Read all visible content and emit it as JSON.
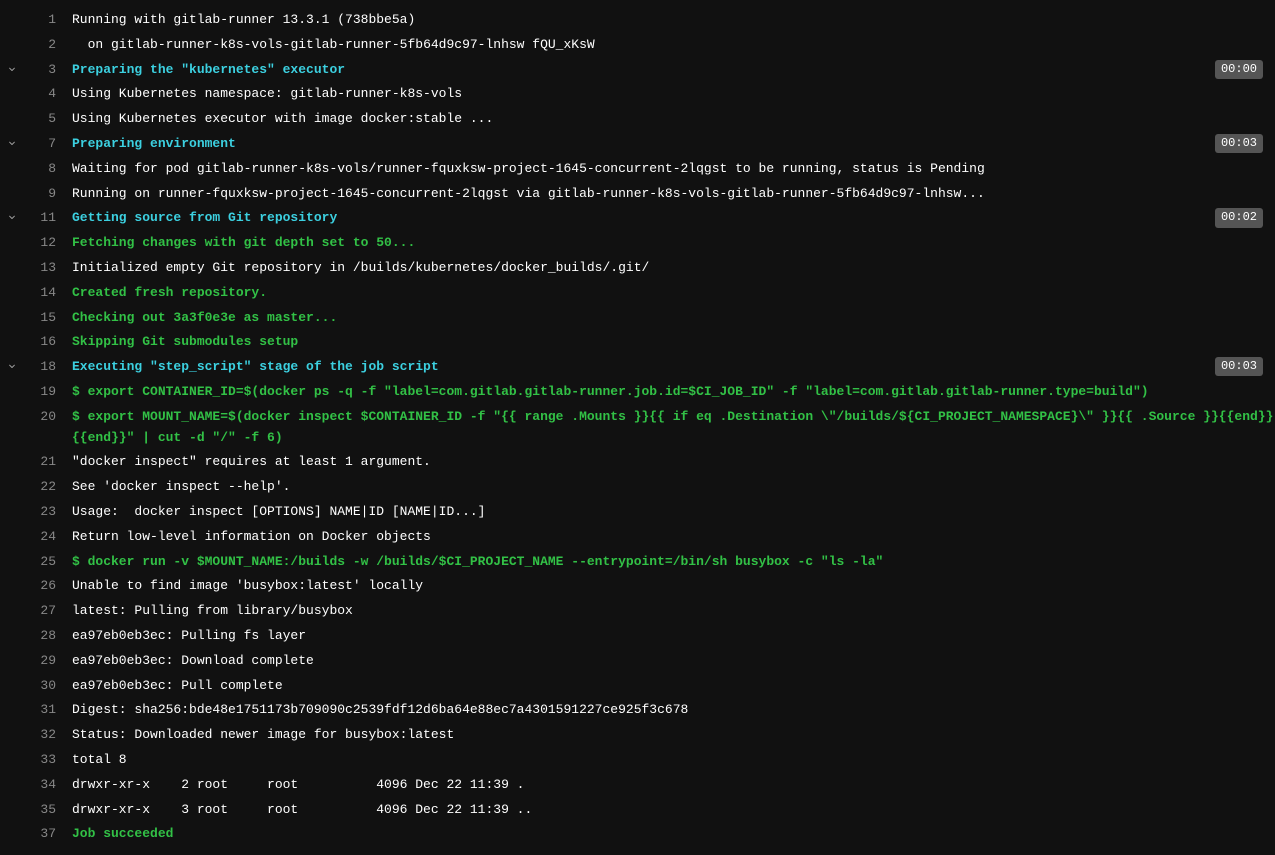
{
  "lines": [
    {
      "num": "1",
      "toggle": false,
      "style": "c-white",
      "text": "Running with gitlab-runner 13.3.1 (738bbe5a)",
      "duration": null
    },
    {
      "num": "2",
      "toggle": false,
      "style": "c-white",
      "text": "  on gitlab-runner-k8s-vols-gitlab-runner-5fb64d9c97-lnhsw fQU_xKsW",
      "duration": null
    },
    {
      "num": "3",
      "toggle": true,
      "style": "c-cyan",
      "text": "Preparing the \"kubernetes\" executor",
      "duration": "00:00"
    },
    {
      "num": "4",
      "toggle": false,
      "style": "c-white",
      "text": "Using Kubernetes namespace: gitlab-runner-k8s-vols",
      "duration": null
    },
    {
      "num": "5",
      "toggle": false,
      "style": "c-white",
      "text": "Using Kubernetes executor with image docker:stable ...",
      "duration": null
    },
    {
      "num": "7",
      "toggle": true,
      "style": "c-cyan",
      "text": "Preparing environment",
      "duration": "00:03"
    },
    {
      "num": "8",
      "toggle": false,
      "style": "c-white",
      "text": "Waiting for pod gitlab-runner-k8s-vols/runner-fquxksw-project-1645-concurrent-2lqgst to be running, status is Pending",
      "duration": null
    },
    {
      "num": "9",
      "toggle": false,
      "style": "c-white",
      "text": "Running on runner-fquxksw-project-1645-concurrent-2lqgst via gitlab-runner-k8s-vols-gitlab-runner-5fb64d9c97-lnhsw...",
      "duration": null
    },
    {
      "num": "11",
      "toggle": true,
      "style": "c-cyan",
      "text": "Getting source from Git repository",
      "duration": "00:02"
    },
    {
      "num": "12",
      "toggle": false,
      "style": "c-green",
      "text": "Fetching changes with git depth set to 50...",
      "duration": null
    },
    {
      "num": "13",
      "toggle": false,
      "style": "c-white",
      "text": "Initialized empty Git repository in /builds/kubernetes/docker_builds/.git/",
      "duration": null
    },
    {
      "num": "14",
      "toggle": false,
      "style": "c-green",
      "text": "Created fresh repository.",
      "duration": null
    },
    {
      "num": "15",
      "toggle": false,
      "style": "c-green",
      "text": "Checking out 3a3f0e3e as master...",
      "duration": null
    },
    {
      "num": "16",
      "toggle": false,
      "style": "c-green",
      "text": "Skipping Git submodules setup",
      "duration": null
    },
    {
      "num": "18",
      "toggle": true,
      "style": "c-cyan",
      "text": "Executing \"step_script\" stage of the job script",
      "duration": "00:03"
    },
    {
      "num": "19",
      "toggle": false,
      "style": "c-green",
      "text": "$ export CONTAINER_ID=$(docker ps -q -f \"label=com.gitlab.gitlab-runner.job.id=$CI_JOB_ID\" -f \"label=com.gitlab.gitlab-runner.type=build\")",
      "duration": null
    },
    {
      "num": "20",
      "toggle": false,
      "style": "c-green",
      "text": "$ export MOUNT_NAME=$(docker inspect $CONTAINER_ID -f \"{{ range .Mounts }}{{ if eq .Destination \\\"/builds/${CI_PROJECT_NAMESPACE}\\\" }}{{ .Source }}{{end}}{{end}}\" | cut -d \"/\" -f 6)",
      "duration": null
    },
    {
      "num": "21",
      "toggle": false,
      "style": "c-white",
      "text": "\"docker inspect\" requires at least 1 argument.",
      "duration": null
    },
    {
      "num": "22",
      "toggle": false,
      "style": "c-white",
      "text": "See 'docker inspect --help'.",
      "duration": null
    },
    {
      "num": "23",
      "toggle": false,
      "style": "c-white",
      "text": "Usage:  docker inspect [OPTIONS] NAME|ID [NAME|ID...]",
      "duration": null
    },
    {
      "num": "24",
      "toggle": false,
      "style": "c-white",
      "text": "Return low-level information on Docker objects",
      "duration": null
    },
    {
      "num": "25",
      "toggle": false,
      "style": "c-green",
      "text": "$ docker run -v $MOUNT_NAME:/builds -w /builds/$CI_PROJECT_NAME --entrypoint=/bin/sh busybox -c \"ls -la\"",
      "duration": null
    },
    {
      "num": "26",
      "toggle": false,
      "style": "c-white",
      "text": "Unable to find image 'busybox:latest' locally",
      "duration": null
    },
    {
      "num": "27",
      "toggle": false,
      "style": "c-white",
      "text": "latest: Pulling from library/busybox",
      "duration": null
    },
    {
      "num": "28",
      "toggle": false,
      "style": "c-white",
      "text": "ea97eb0eb3ec: Pulling fs layer",
      "duration": null
    },
    {
      "num": "29",
      "toggle": false,
      "style": "c-white",
      "text": "ea97eb0eb3ec: Download complete",
      "duration": null
    },
    {
      "num": "30",
      "toggle": false,
      "style": "c-white",
      "text": "ea97eb0eb3ec: Pull complete",
      "duration": null
    },
    {
      "num": "31",
      "toggle": false,
      "style": "c-white",
      "text": "Digest: sha256:bde48e1751173b709090c2539fdf12d6ba64e88ec7a4301591227ce925f3c678",
      "duration": null
    },
    {
      "num": "32",
      "toggle": false,
      "style": "c-white",
      "text": "Status: Downloaded newer image for busybox:latest",
      "duration": null
    },
    {
      "num": "33",
      "toggle": false,
      "style": "c-white",
      "text": "total 8",
      "duration": null
    },
    {
      "num": "34",
      "toggle": false,
      "style": "c-white",
      "text": "drwxr-xr-x    2 root     root          4096 Dec 22 11:39 .",
      "duration": null
    },
    {
      "num": "35",
      "toggle": false,
      "style": "c-white",
      "text": "drwxr-xr-x    3 root     root          4096 Dec 22 11:39 ..",
      "duration": null
    },
    {
      "num": "37",
      "toggle": false,
      "style": "c-green",
      "text": "Job succeeded",
      "duration": null
    }
  ]
}
